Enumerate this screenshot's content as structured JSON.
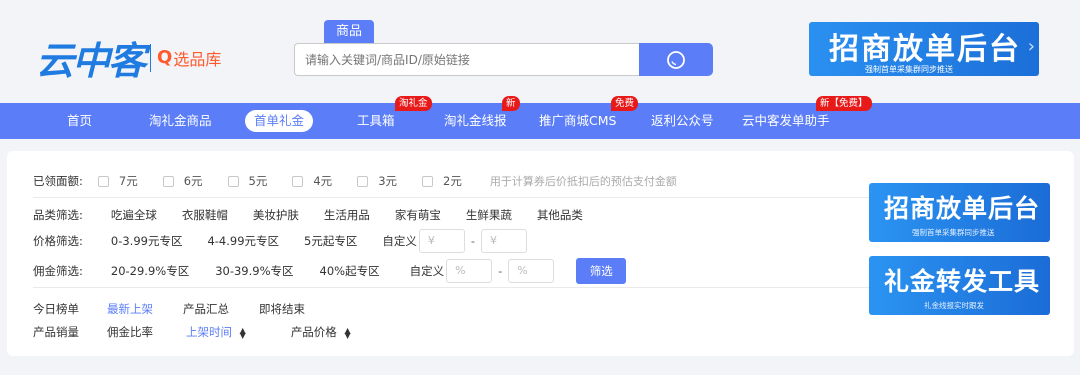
{
  "logo": {
    "main": "云中客",
    "q": "Q",
    "sub": "选品库"
  },
  "search": {
    "tab": "商品",
    "placeholder": "请输入关键词/商品ID/原始链接",
    "button_icon": "search-icon"
  },
  "promo": {
    "title": "招商放单后台",
    "subtitle": "强制首单采集群同步推送"
  },
  "nav": {
    "items": [
      {
        "label": "首页"
      },
      {
        "label": "淘礼金商品"
      },
      {
        "label": "首单礼金",
        "active": true
      },
      {
        "label": "工具箱",
        "badge": "淘礼金"
      },
      {
        "label": "淘礼金线报",
        "badge": "新"
      },
      {
        "label": "推广商城CMS",
        "badge": "免费"
      },
      {
        "label": "返利公众号"
      },
      {
        "label": "云中客发单助手",
        "badge": "新【免费】"
      }
    ]
  },
  "filters": {
    "coupon": {
      "label": "已领面额:",
      "options": [
        "7元",
        "6元",
        "5元",
        "4元",
        "3元",
        "2元"
      ],
      "hint": "用于计算券后价抵扣后的预估支付金额"
    },
    "category": {
      "label": "品类筛选:",
      "options": [
        "吃遍全球",
        "衣服鞋帽",
        "美妆护肤",
        "生活用品",
        "家有萌宝",
        "生鲜果蔬",
        "其他品类"
      ]
    },
    "price": {
      "label": "价格筛选:",
      "options": [
        "0-3.99元专区",
        "4-4.99元专区",
        "5元起专区"
      ],
      "custom_label": "自定义",
      "placeholder_min": "¥",
      "placeholder_max": "¥"
    },
    "commission": {
      "label": "佣金筛选:",
      "options": [
        "20-29.9%专区",
        "30-39.9%专区",
        "40%起专区"
      ],
      "custom_label": "自定义",
      "placeholder_min": "%",
      "placeholder_max": "%",
      "button": "筛选"
    }
  },
  "tabs": {
    "items": [
      "今日榜单",
      "最新上架",
      "产品汇总",
      "即将结束"
    ],
    "active_index": 1
  },
  "sort": {
    "items": [
      "产品销量",
      "佣金比率",
      "上架时间",
      "产品价格"
    ],
    "active_index": 2,
    "sort_icon": "▲▼"
  },
  "side_banners": [
    {
      "title": "招商放单后台",
      "subtitle": "强制首单采集群同步推送"
    },
    {
      "title": "礼金转发工具",
      "subtitle": "礼金线报实时跟发"
    }
  ],
  "colors": {
    "accent": "#5b7df7",
    "badge": "#e81919",
    "logo": "#1f7be0",
    "logo_sub": "#ff5a2d"
  }
}
